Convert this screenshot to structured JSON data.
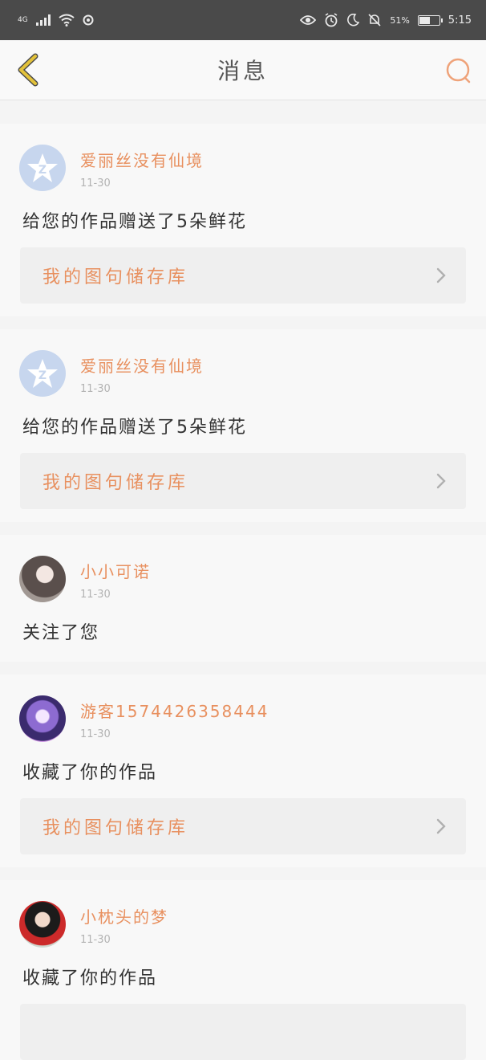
{
  "status_bar": {
    "network": "4G",
    "battery_percent": "51%",
    "time": "5:15"
  },
  "header": {
    "title": "消息"
  },
  "messages": [
    {
      "username": "爱丽丝没有仙境",
      "date": "11-30",
      "text": "给您的作品赠送了5朵鲜花",
      "link": "我的图句储存库",
      "avatar": "qq"
    },
    {
      "username": "爱丽丝没有仙境",
      "date": "11-30",
      "text": "给您的作品赠送了5朵鲜花",
      "link": "我的图句储存库",
      "avatar": "qq"
    },
    {
      "username": "小小可诺",
      "date": "11-30",
      "text": "关注了您",
      "link": "",
      "avatar": "p1"
    },
    {
      "username": "游客1574426358444",
      "date": "11-30",
      "text": "收藏了你的作品",
      "link": "我的图句储存库",
      "avatar": "p2"
    },
    {
      "username": "小枕头的梦",
      "date": "11-30",
      "text": "收藏了你的作品",
      "link": "",
      "avatar": "p3"
    }
  ],
  "colors": {
    "accent": "#e8905f",
    "back_icon": "#e3c23a",
    "search_icon": "#efa37a"
  }
}
